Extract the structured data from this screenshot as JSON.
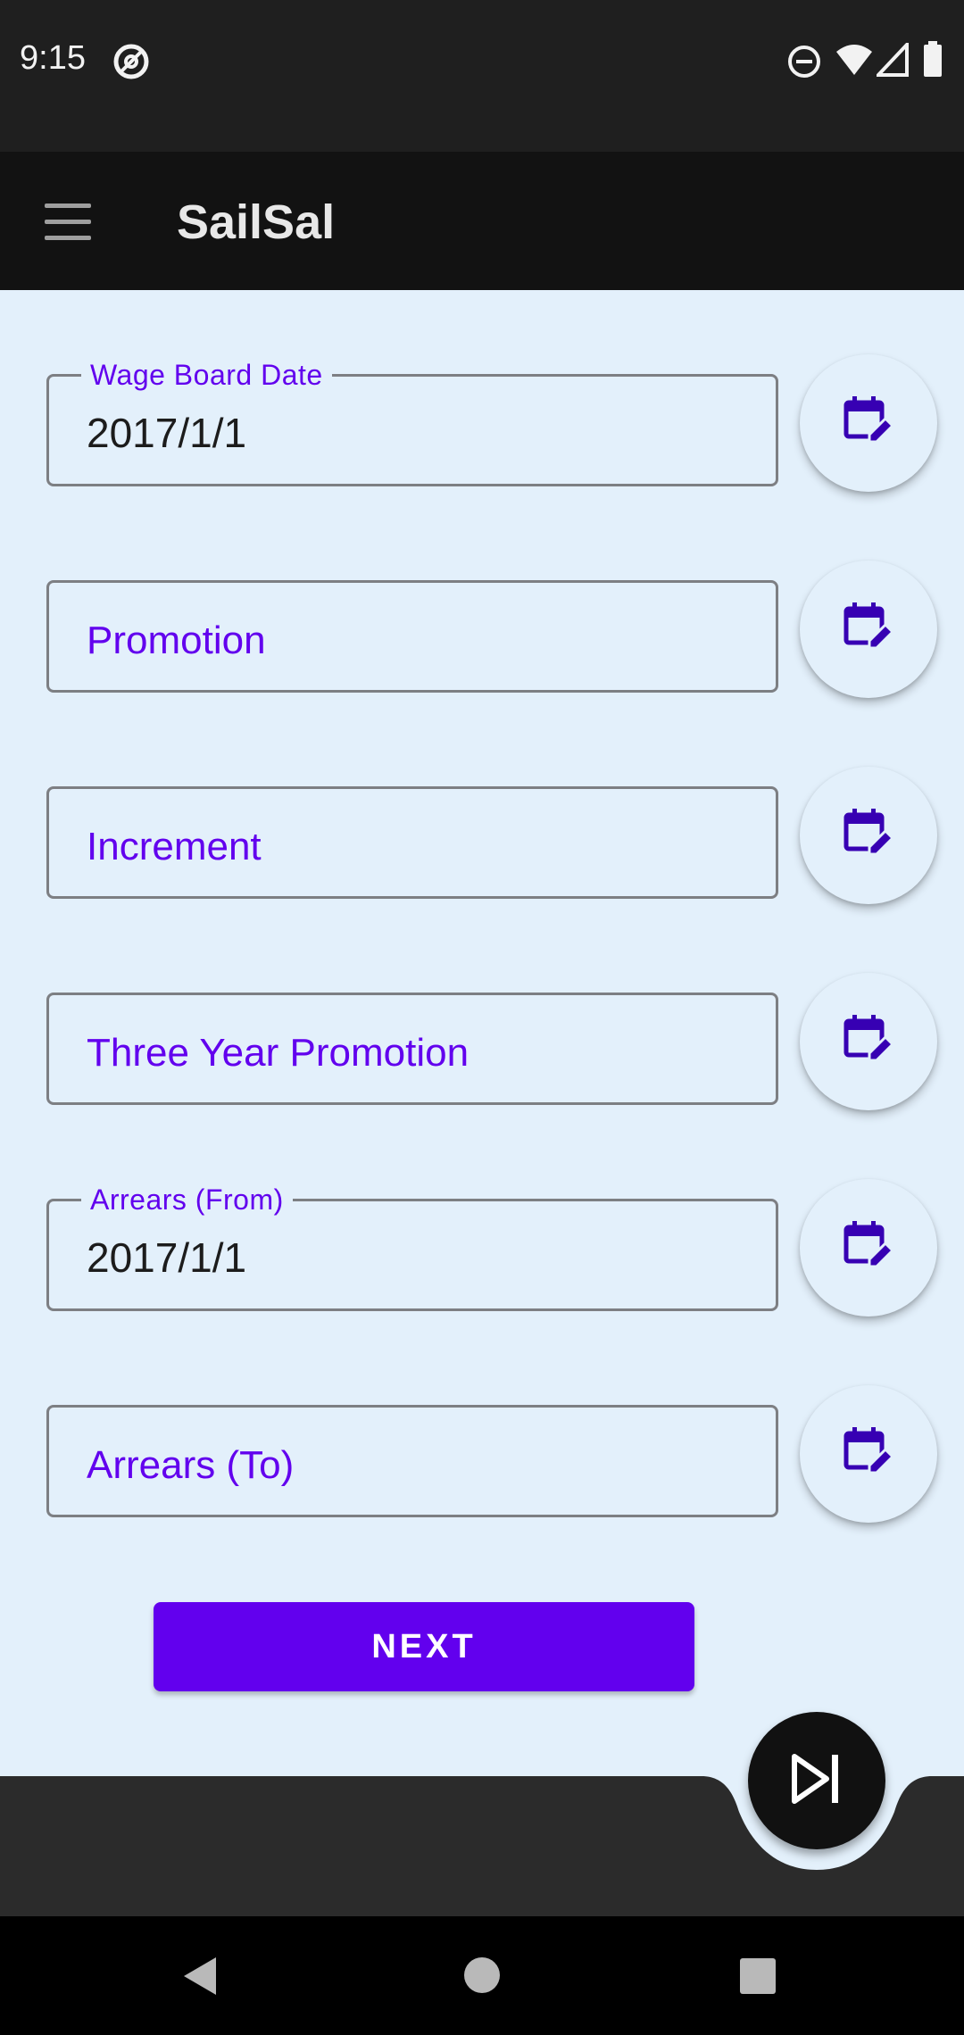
{
  "status_bar": {
    "time": "9:15",
    "icons": [
      "at-sign-icon",
      "do-not-disturb-icon",
      "wifi-icon",
      "signal-icon",
      "battery-icon"
    ]
  },
  "app_bar": {
    "title": "SailSal",
    "menu_icon": "hamburger-menu-icon"
  },
  "fields": [
    {
      "label": "Wage Board Date",
      "value": "2017/1/1",
      "placeholder": ""
    },
    {
      "label": "",
      "value": "",
      "placeholder": "Promotion"
    },
    {
      "label": "",
      "value": "",
      "placeholder": "Increment"
    },
    {
      "label": "",
      "value": "",
      "placeholder": "Three Year Promotion"
    },
    {
      "label": "Arrears (From)",
      "value": "2017/1/1",
      "placeholder": ""
    },
    {
      "label": "",
      "value": "",
      "placeholder": "Arrears (To)"
    }
  ],
  "field_icon": "calendar-edit-icon",
  "next_button": {
    "label": "NEXT"
  },
  "fab": {
    "icon": "skip-next-icon"
  },
  "nav_bar": {
    "icons": [
      "back-icon",
      "home-icon",
      "recents-icon"
    ]
  },
  "colors": {
    "accent": "#6200ee",
    "icon_purple": "#3700b3",
    "background": "#e3f0fb",
    "bar_dark": "#121212",
    "bottom_bar": "#2b2b2b"
  }
}
